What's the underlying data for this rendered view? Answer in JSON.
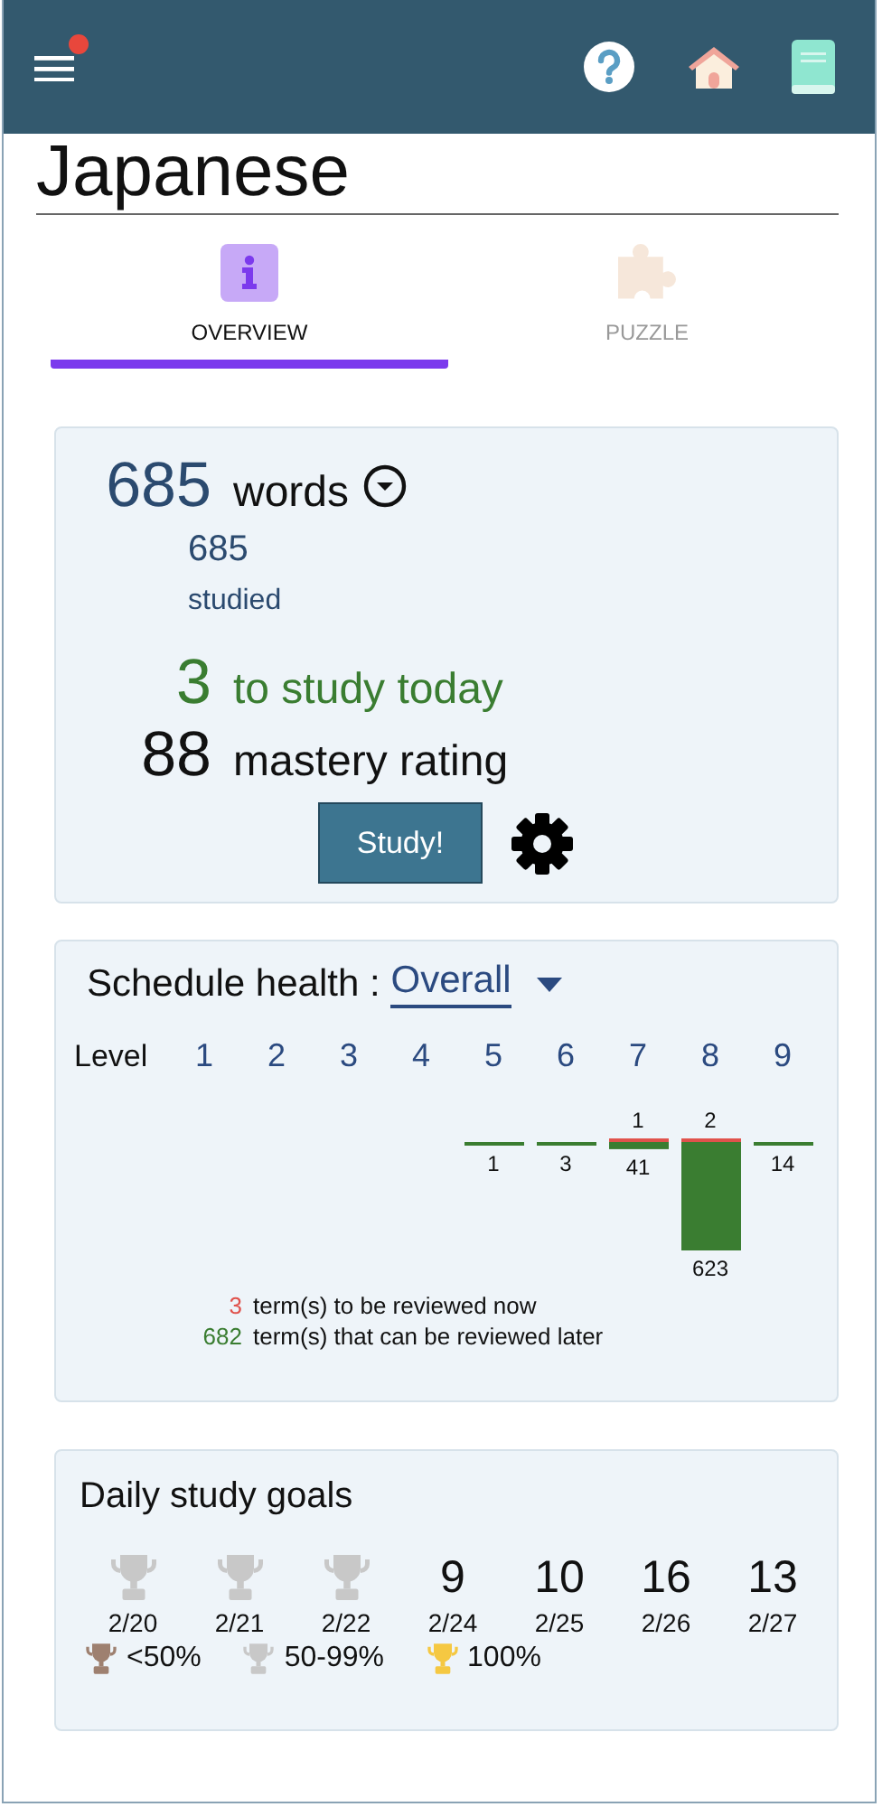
{
  "header": {
    "menu_notification": true
  },
  "title": "Japanese",
  "tabs": [
    {
      "label": "OVERVIEW",
      "kind": "info",
      "selected": true
    },
    {
      "label": "PUZZLE",
      "kind": "puzzle",
      "selected": false
    }
  ],
  "summary": {
    "total": "685",
    "total_label": "words",
    "studied": "685",
    "studied_label": "studied",
    "today": "3",
    "today_label": "to study today",
    "mastery": "88",
    "mastery_label": "mastery rating",
    "study_button": "Study!"
  },
  "schedule": {
    "title": "Schedule health :",
    "filter": "Overall",
    "axis_label": "Level",
    "levels": [
      {
        "level": "1"
      },
      {
        "level": "2"
      },
      {
        "level": "3"
      },
      {
        "level": "4"
      },
      {
        "level": "5",
        "later": "1"
      },
      {
        "level": "6",
        "later": "3"
      },
      {
        "level": "7",
        "due": "1",
        "later": "41"
      },
      {
        "level": "8",
        "due": "2",
        "later": "623"
      },
      {
        "level": "9",
        "later": "14"
      }
    ],
    "legend": [
      {
        "kind": "due",
        "count": "3",
        "text": "term(s) to be reviewed now",
        "color": "#e0524c"
      },
      {
        "kind": "later",
        "count": "682",
        "text": "term(s) that can be reviewed later",
        "color": "#3a7d31"
      }
    ]
  },
  "goals": {
    "title": "Daily study goals",
    "days": [
      {
        "kind": "trophy",
        "color": "#c8c8c8",
        "date": "2/20"
      },
      {
        "kind": "trophy",
        "color": "#c8c8c8",
        "date": "2/21"
      },
      {
        "kind": "trophy",
        "color": "#c8c8c8",
        "date": "2/22"
      },
      {
        "kind": "count",
        "value": "9",
        "date": "2/24"
      },
      {
        "kind": "count",
        "value": "10",
        "date": "2/25"
      },
      {
        "kind": "count",
        "value": "16",
        "date": "2/26"
      },
      {
        "kind": "count",
        "value": "13",
        "date": "2/27"
      }
    ],
    "legend": [
      {
        "color": "#9e8070",
        "label": "<50%"
      },
      {
        "color": "#c8c8c8",
        "label": "50-99%"
      },
      {
        "color": "#f5c842",
        "label": "100%"
      }
    ]
  }
}
